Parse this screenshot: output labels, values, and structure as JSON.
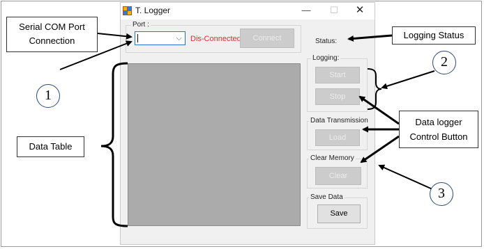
{
  "window": {
    "title": "T. Logger",
    "minimize_glyph": "—",
    "maximize_glyph": "☐",
    "close_glyph": "✕"
  },
  "port": {
    "label": "Port :",
    "combo_value": "",
    "status_text": "Dis-Connected",
    "connect_label": "Connect"
  },
  "status": {
    "label": "Status:"
  },
  "logging": {
    "label": "Logging:",
    "start_label": "Start",
    "stop_label": "Stop"
  },
  "transmission": {
    "label": "Data Transmission",
    "load_label": "Load"
  },
  "clear_memory": {
    "label": "Clear Memory",
    "clear_label": "Clear"
  },
  "save_data": {
    "label": "Save Data",
    "save_label": "Save"
  },
  "annotations": {
    "serial_com": [
      "Serial COM Port",
      "Connection"
    ],
    "logging_status": "Logging Status",
    "data_table": "Data Table",
    "control_button": [
      "Data logger",
      "Control Button"
    ],
    "circle_1": "1",
    "circle_2": "2",
    "circle_3": "3"
  },
  "colors": {
    "disconnected": "#e0302a",
    "table": "#ababab",
    "window_bg": "#f0f0f0"
  }
}
